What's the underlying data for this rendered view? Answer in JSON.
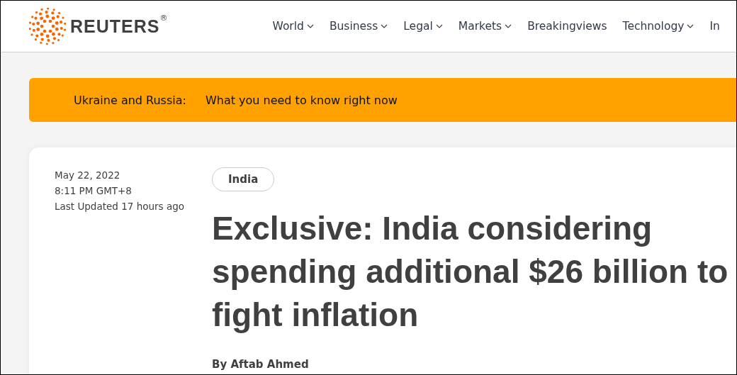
{
  "header": {
    "logo": {
      "text": "REUTERS",
      "mark": "®"
    },
    "nav": [
      {
        "label": "World",
        "dropdown": true
      },
      {
        "label": "Business",
        "dropdown": true
      },
      {
        "label": "Legal",
        "dropdown": true
      },
      {
        "label": "Markets",
        "dropdown": true
      },
      {
        "label": "Breakingviews",
        "dropdown": false
      },
      {
        "label": "Technology",
        "dropdown": true
      },
      {
        "label": "In",
        "dropdown": false
      }
    ]
  },
  "banner": {
    "topic": "Ukraine and Russia:",
    "link": "What you need to know right now"
  },
  "article": {
    "date": "May 22, 2022",
    "time": "8:11 PM GMT+8",
    "updated": "Last Updated 17 hours ago",
    "tag": "India",
    "headline": "Exclusive: India considering spending additional $26 billion to fight inflation",
    "byline": "By Aftab Ahmed"
  }
}
